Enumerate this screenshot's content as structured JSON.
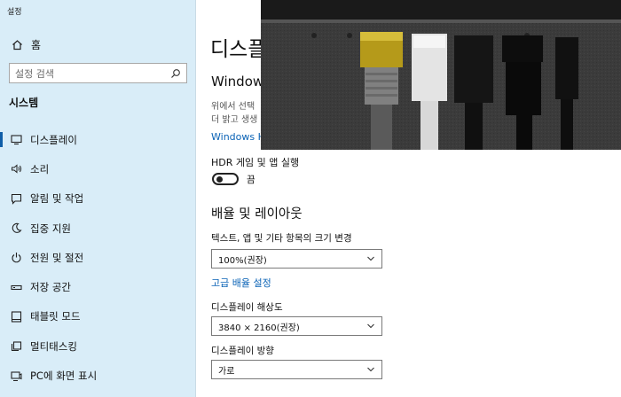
{
  "app_title": "설정",
  "sidebar": {
    "home_label": "홈",
    "search_placeholder": "설정 검색",
    "section_title": "시스템",
    "items": [
      {
        "label": "디스플레이",
        "icon": "monitor-icon",
        "active": true
      },
      {
        "label": "소리",
        "icon": "speaker-icon"
      },
      {
        "label": "알림 및 작업",
        "icon": "notification-icon"
      },
      {
        "label": "집중 지원",
        "icon": "moon-icon"
      },
      {
        "label": "전원 및 절전",
        "icon": "power-icon"
      },
      {
        "label": "저장 공간",
        "icon": "storage-icon"
      },
      {
        "label": "태블릿 모드",
        "icon": "tablet-icon"
      },
      {
        "label": "멀티태스킹",
        "icon": "multitasking-icon"
      },
      {
        "label": "PC에 화면 표시",
        "icon": "project-icon"
      }
    ]
  },
  "main": {
    "page_title": "디스플",
    "subhead": "Windows",
    "desc_line1": "위에서 선택",
    "desc_line2": "더 밝고 생생",
    "win_link": "Windows H",
    "hdr_label": "HDR 게임 및 앱 실행",
    "hdr_toggle_state": "끔",
    "hdr_on": false,
    "scale_section": "배율 및 레이아웃",
    "scale_label": "텍스트, 앱 및 기타 항목의 크기 변경",
    "scale_value": "100%(권장)",
    "advanced_scaling_link": "고급 배율 설정",
    "resolution_label": "디스플레이 해상도",
    "resolution_value": "3840 × 2160(권장)",
    "orientation_label": "디스플레이 방향",
    "orientation_value": "가로"
  },
  "colors": {
    "sidebar_bg": "#d9edf8",
    "accent": "#0f5ea8",
    "link": "#0b63b6"
  }
}
